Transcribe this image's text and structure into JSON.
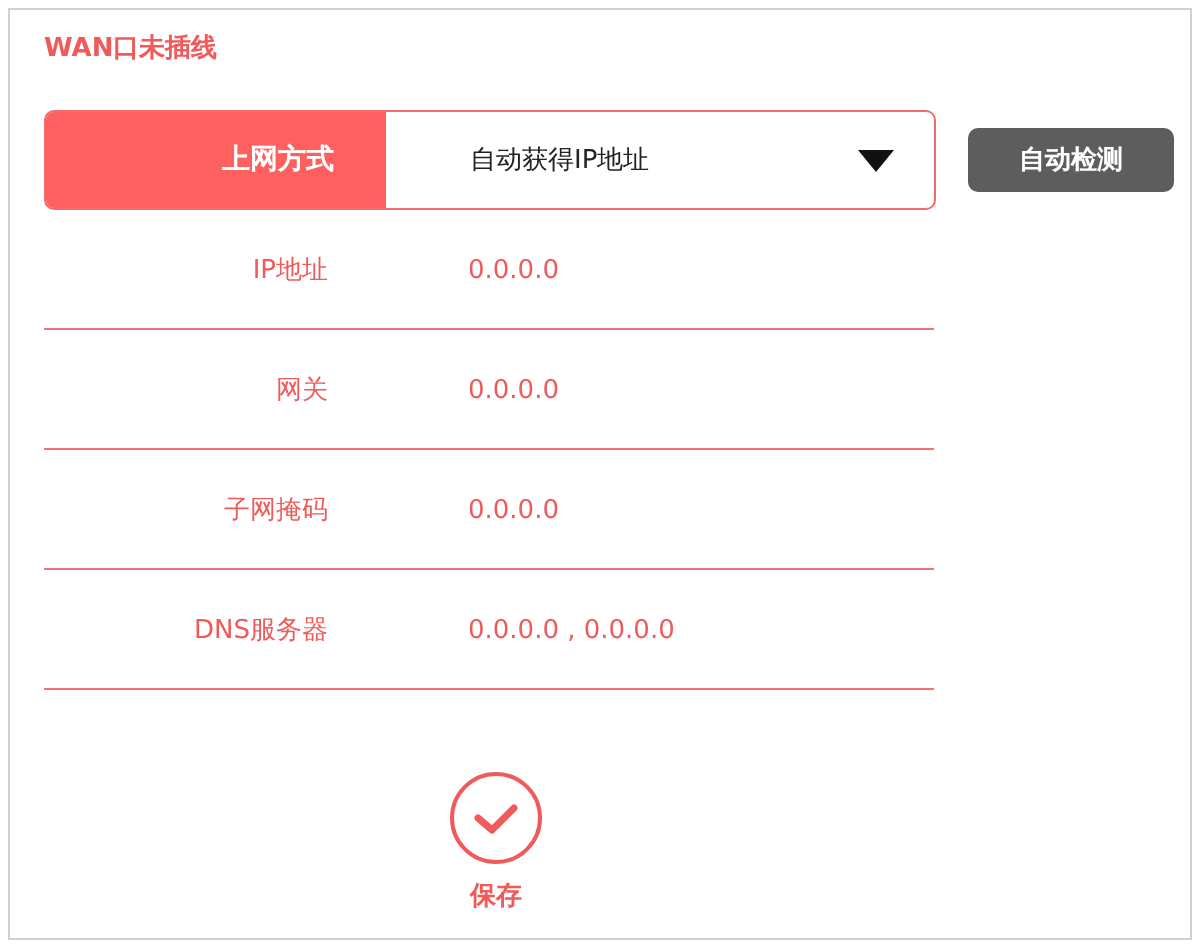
{
  "title": "WAN口未插线",
  "connection": {
    "label": "上网方式",
    "value": "自动获得IP地址"
  },
  "detect_button": "自动检测",
  "fields": [
    {
      "label": "IP地址",
      "value": "0.0.0.0"
    },
    {
      "label": "网关",
      "value": "0.0.0.0"
    },
    {
      "label": "子网掩码",
      "value": "0.0.0.0"
    },
    {
      "label": "DNS服务器",
      "value": "0.0.0.0 , 0.0.0.0"
    }
  ],
  "save_button": "保存"
}
